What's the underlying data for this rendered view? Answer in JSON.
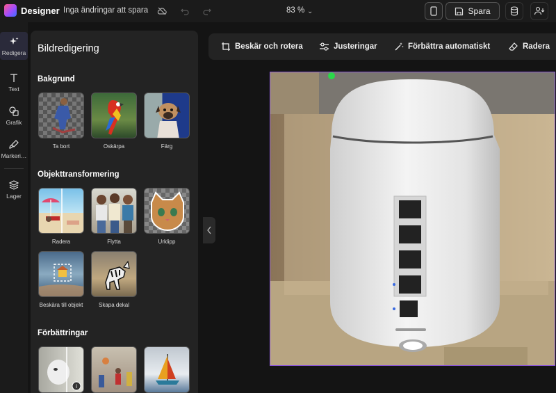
{
  "header": {
    "app_name": "Designer",
    "status": "Inga ändringar att spara",
    "zoom": "83 %",
    "save_label": "Spara"
  },
  "sidenav": {
    "items": [
      {
        "label": "Redigera",
        "icon": "sparkle-icon"
      },
      {
        "label": "Text",
        "icon": "text-icon"
      },
      {
        "label": "Grafik",
        "icon": "shapes-icon"
      },
      {
        "label": "Markeri…",
        "icon": "brush-icon"
      },
      {
        "label": "Lager",
        "icon": "layers-icon"
      }
    ]
  },
  "panel": {
    "title": "Bildredigering",
    "sections": [
      {
        "title": "Bakgrund",
        "items": [
          "Ta bort",
          "Oskärpa",
          "Färg"
        ]
      },
      {
        "title": "Objekttransformering",
        "items": [
          "Radera",
          "Flytta",
          "Urklipp",
          "Beskära till objekt",
          "Skapa dekal"
        ]
      },
      {
        "title": "Förbättringar",
        "items": []
      }
    ]
  },
  "toolbar": {
    "crop": "Beskär och rotera",
    "adjust": "Justeringar",
    "enhance": "Förbättra automatiskt",
    "erase": "Radera"
  },
  "colors": {
    "accent_selection": "#8a55d8",
    "background": "#141414",
    "panel": "#232323"
  }
}
